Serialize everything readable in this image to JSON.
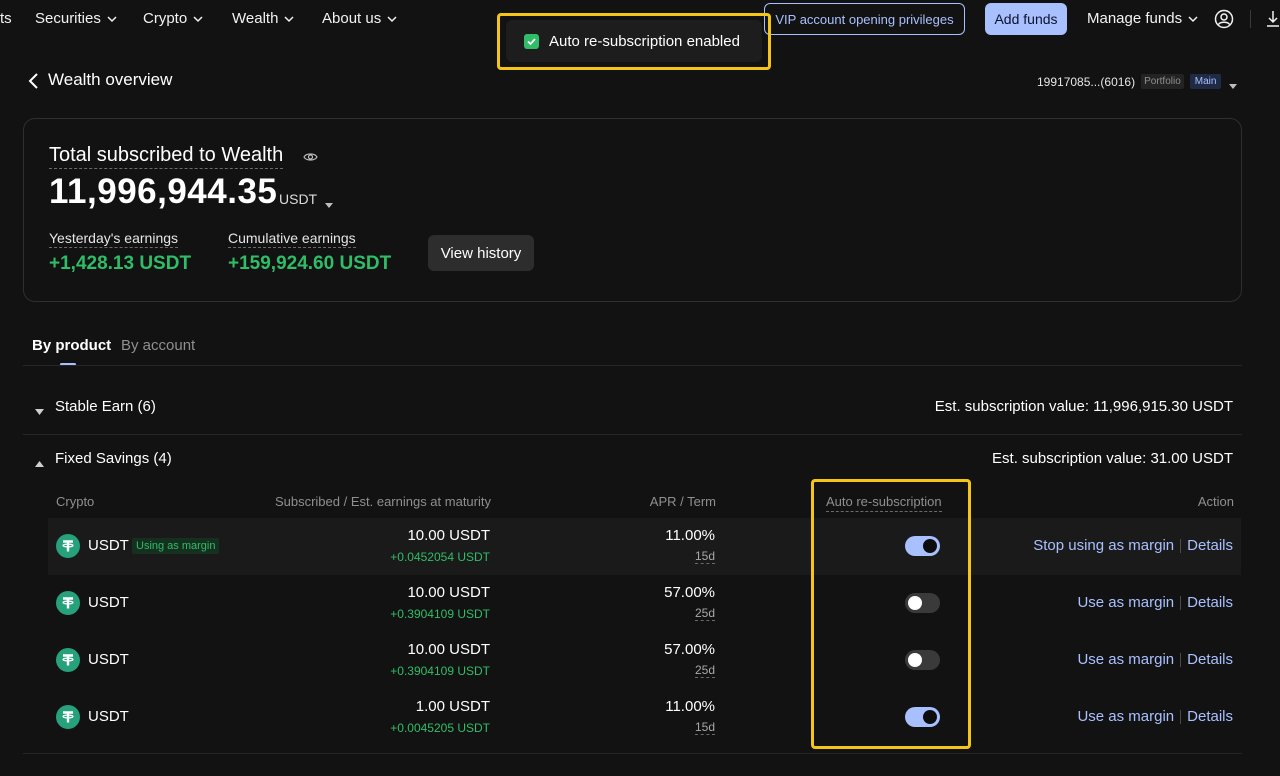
{
  "nav": {
    "partial_item": "ts",
    "items": [
      "Securities",
      "Crypto",
      "Wealth",
      "About us"
    ],
    "vip_label": "VIP account opening privileges",
    "add_funds_label": "Add funds",
    "manage_funds_label": "Manage funds"
  },
  "toast": {
    "message": "Auto re-subscription enabled",
    "icon": "check-icon"
  },
  "header": {
    "title": "Wealth overview",
    "account_id": "19917085...(6016)",
    "portfolio_tag": "Portfolio",
    "main_tag": "Main"
  },
  "summary": {
    "label": "Total subscribed to Wealth",
    "value": "11,996,944.35",
    "currency": "USDT",
    "yesterday_label": "Yesterday's earnings",
    "yesterday_value": "+1,428.13 USDT",
    "cumulative_label": "Cumulative earnings",
    "cumulative_value": "+159,924.60 USDT",
    "view_history_label": "View history"
  },
  "tabs": [
    {
      "label": "By product",
      "active": true
    },
    {
      "label": "By account",
      "active": false
    }
  ],
  "groups": {
    "stable": {
      "title": "Stable Earn (6)",
      "value": "Est. subscription value: 11,996,915.30 USDT",
      "expanded": false
    },
    "fixed": {
      "title": "Fixed Savings (4)",
      "value": "Est. subscription value: 31.00 USDT",
      "expanded": true
    }
  },
  "table": {
    "headers": {
      "crypto": "Crypto",
      "subscribed": "Subscribed / Est. earnings at maturity",
      "apr": "APR / Term",
      "auto": "Auto re-subscription",
      "action": "Action"
    },
    "rows": [
      {
        "coin": "USDT",
        "badge": "Using as margin",
        "subscribed": "10.00 USDT",
        "earnings": "+0.0452054 USDT",
        "apr": "11.00%",
        "term": "15d",
        "auto_resubscribe": true,
        "action1": "Stop using as margin",
        "action2": "Details"
      },
      {
        "coin": "USDT",
        "badge": "",
        "subscribed": "10.00 USDT",
        "earnings": "+0.3904109 USDT",
        "apr": "57.00%",
        "term": "25d",
        "auto_resubscribe": false,
        "action1": "Use as margin",
        "action2": "Details"
      },
      {
        "coin": "USDT",
        "badge": "",
        "subscribed": "10.00 USDT",
        "earnings": "+0.3904109 USDT",
        "apr": "57.00%",
        "term": "25d",
        "auto_resubscribe": false,
        "action1": "Use as margin",
        "action2": "Details"
      },
      {
        "coin": "USDT",
        "badge": "",
        "subscribed": "1.00 USDT",
        "earnings": "+0.0045205 USDT",
        "apr": "11.00%",
        "term": "15d",
        "auto_resubscribe": true,
        "action1": "Use as margin",
        "action2": "Details"
      }
    ]
  },
  "colors": {
    "background": "#121212",
    "accent": "#a9c0ff",
    "positive": "#2fbd67",
    "highlight": "#f4c417",
    "tether": "#26a17b"
  }
}
